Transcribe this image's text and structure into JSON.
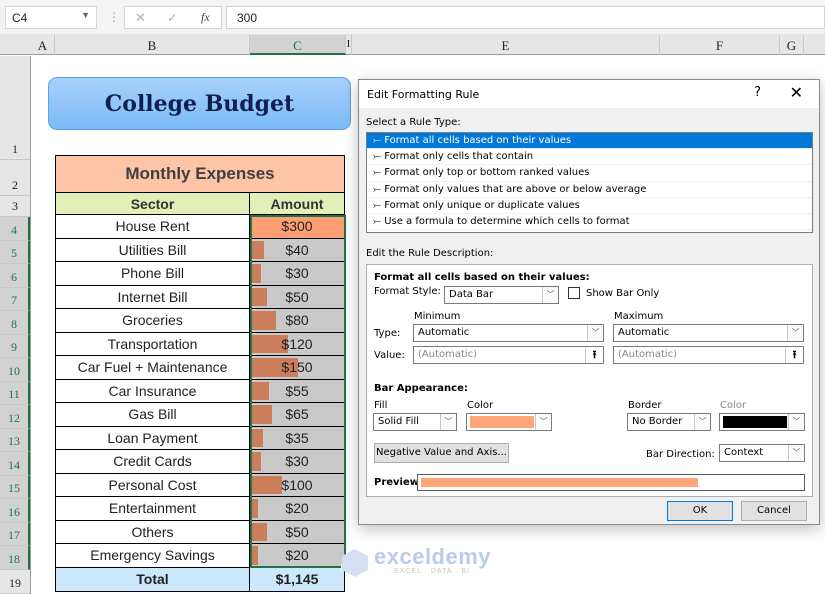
{
  "formula_bar": {
    "name_box": "C4",
    "formula_value": "300",
    "cancel_icon": "close-icon",
    "enter_icon": "check-icon",
    "fx_label": "fx"
  },
  "columns": [
    "A",
    "B",
    "C",
    "I",
    "E",
    "F",
    "G"
  ],
  "selected_column": "C",
  "rows": [
    "1",
    "2",
    "3",
    "4",
    "5",
    "6",
    "7",
    "8",
    "9",
    "10",
    "11",
    "12",
    "13",
    "14",
    "15",
    "16",
    "17",
    "18",
    "19"
  ],
  "sheet": {
    "title": "College Budget",
    "table_title": "Monthly Expenses",
    "headers": [
      "Sector",
      "Amount"
    ],
    "items": [
      {
        "sector": "House Rent",
        "amount": "$300",
        "value": 300
      },
      {
        "sector": "Utilities Bill",
        "amount": "$40",
        "value": 40
      },
      {
        "sector": "Phone Bill",
        "amount": "$30",
        "value": 30
      },
      {
        "sector": "Internet Bill",
        "amount": "$50",
        "value": 50
      },
      {
        "sector": "Groceries",
        "amount": "$80",
        "value": 80
      },
      {
        "sector": "Transportation",
        "amount": "$120",
        "value": 120
      },
      {
        "sector": "Car Fuel + Maintenance",
        "amount": "$150",
        "value": 150
      },
      {
        "sector": "Car Insurance",
        "amount": "$55",
        "value": 55
      },
      {
        "sector": "Gas Bill",
        "amount": "$65",
        "value": 65
      },
      {
        "sector": "Loan Payment",
        "amount": "$35",
        "value": 35
      },
      {
        "sector": "Credit Cards",
        "amount": "$30",
        "value": 30
      },
      {
        "sector": "Personal Cost",
        "amount": "$100",
        "value": 100
      },
      {
        "sector": "Entertainment",
        "amount": "$20",
        "value": 20
      },
      {
        "sector": "Others",
        "amount": "$50",
        "value": 50
      },
      {
        "sector": "Emergency Savings",
        "amount": "$20",
        "value": 20
      }
    ],
    "total_label": "Total",
    "total_value": "$1,145"
  },
  "dialog": {
    "title": "Edit Formatting Rule",
    "help": "?",
    "close": "✕",
    "select_rule_label": "Select a Rule Type:",
    "rule_types": [
      "Format all cells based on their values",
      "Format only cells that contain",
      "Format only top or bottom ranked values",
      "Format only values that are above or below average",
      "Format only unique or duplicate values",
      "Use a formula to determine which cells to format"
    ],
    "selected_rule_index": 0,
    "edit_desc_label": "Edit the Rule Description:",
    "desc_heading": "Format all cells based on their values:",
    "format_style_label": "Format Style:",
    "format_style_value": "Data Bar",
    "show_bar_only_label": "Show Bar Only",
    "show_bar_only_checked": false,
    "minimum_label": "Minimum",
    "maximum_label": "Maximum",
    "type_label": "Type:",
    "value_label": "Value:",
    "min_type": "Automatic",
    "max_type": "Automatic",
    "min_value_placeholder": "(Automatic)",
    "max_value_placeholder": "(Automatic)",
    "bar_appearance_label": "Bar Appearance:",
    "fill_label": "Fill",
    "fill_value": "Solid Fill",
    "color_label": "Color",
    "fill_color": "#fea67a",
    "border_label": "Border",
    "border_value": "No Border",
    "border_color_label": "Color",
    "border_color": "#000000",
    "negative_btn": "Negative Value and Axis...",
    "bar_direction_label": "Bar Direction:",
    "bar_direction_value": "Context",
    "preview_label": "Preview:",
    "preview_fill_fraction": 0.73,
    "ok": "OK",
    "cancel": "Cancel"
  },
  "watermark": {
    "name": "exceldemy",
    "tagline": "EXCEL · DATA · BI"
  }
}
